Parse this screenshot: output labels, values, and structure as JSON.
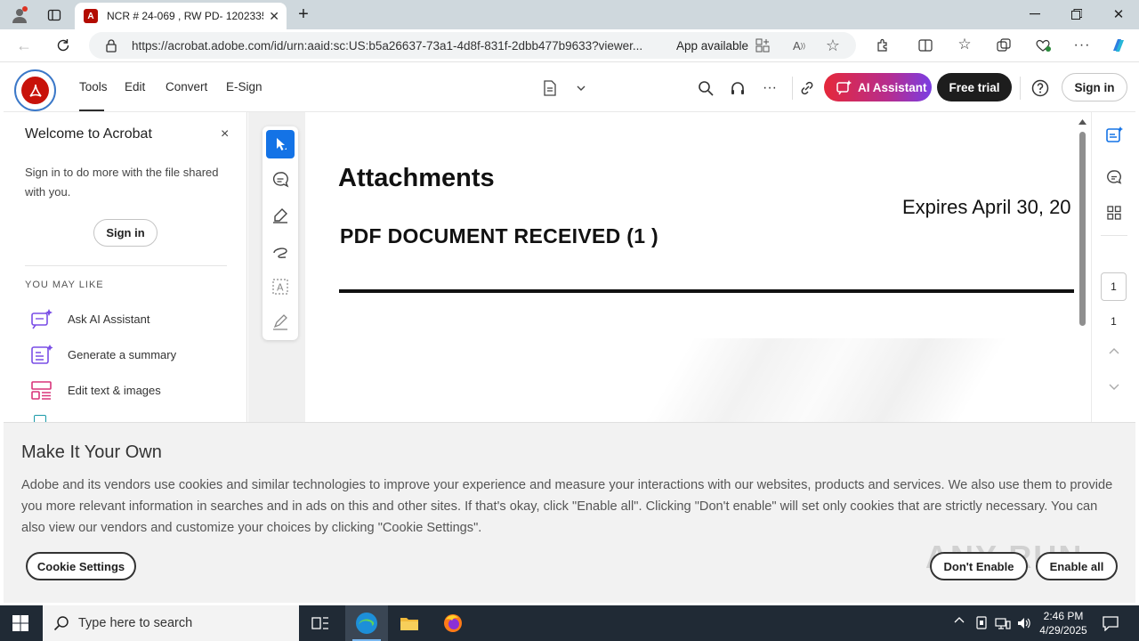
{
  "browser": {
    "tab_title": "NCR # 24-069 , RW PD- 1202335",
    "url": "https://acrobat.adobe.com/id/urn:aaid:sc:US:b5a26637-73a1-4d8f-831f-2dbb477b9633?viewer...",
    "app_available": "App available"
  },
  "acrobat": {
    "nav": [
      "Tools",
      "Edit",
      "Convert",
      "E-Sign"
    ],
    "ai_assistant": "AI Assistant",
    "free_trial": "Free trial",
    "sign_in": "Sign in"
  },
  "sidepanel": {
    "title": "Welcome to Acrobat",
    "close": "×",
    "description": "Sign in to do more with the file shared with you.",
    "sign_in": "Sign in",
    "section_label": "YOU MAY LIKE",
    "suggestions": [
      {
        "label": "Ask AI Assistant",
        "icon": "ai-assistant-icon"
      },
      {
        "label": "Generate a summary",
        "icon": "summary-icon"
      },
      {
        "label": "Edit text & images",
        "icon": "edit-text-images-icon"
      }
    ]
  },
  "document": {
    "heading": "Attachments",
    "expires": "Expires April 30, 20",
    "subheading": "PDF DOCUMENT RECEIVED (1 )"
  },
  "pager": {
    "current": "1",
    "total": "1"
  },
  "cookie": {
    "title": "Make It Your Own",
    "body": "Adobe and its vendors use cookies and similar technologies to improve your experience and measure your interactions with our websites, products and services. We also use them to provide you more relevant information in searches and in ads on this and other sites. If that's okay, click \"Enable all\". Clicking \"Don't enable\" will set only cookies that are strictly necessary. You can also view our vendors and customize your choices by clicking \"Cookie Settings\".",
    "settings": "Cookie Settings",
    "dont_enable": "Don't Enable",
    "enable_all": "Enable all",
    "watermark": "ANY RUN"
  },
  "taskbar": {
    "search_placeholder": "Type here to search",
    "time": "2:46 PM",
    "date": "4/29/2025"
  },
  "colors": {
    "acrobat_red": "#c8120a",
    "tool_active": "#1473e6",
    "taskbar": "#202a35"
  }
}
